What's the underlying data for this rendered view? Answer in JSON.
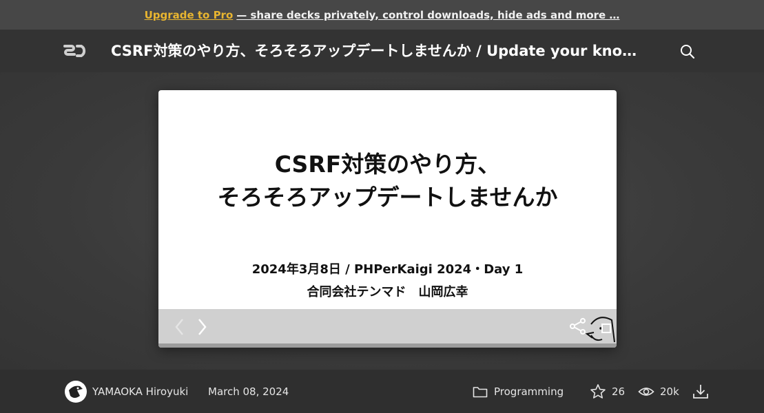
{
  "promo": {
    "link_label": "Upgrade to Pro",
    "rest_label": "— share decks privately, control downloads, hide ads and more …",
    "accent_color": "#e8b530"
  },
  "header": {
    "logo_icon": "speakerdeck-logo-icon",
    "title": "CSRF対策のやり方、そろそろアップデートしませんか / Update your knowledge of CSRF protection",
    "search_icon": "search-icon"
  },
  "slide": {
    "title_line1": "CSRF対策のやり方、",
    "title_line2": "そろそろアップデートしませんか",
    "subtitle_line1": "2024年3月8日 / PHPerKaigi 2024・Day 1",
    "subtitle_line2": "合同会社テンマド　山岡広幸",
    "controls": [
      "prev-icon",
      "next-icon",
      "share-icon",
      "fullscreen-icon"
    ]
  },
  "footer": {
    "author": "YAMAOKA Hiroyuki",
    "date": "March 08, 2024",
    "category": "Programming",
    "stars": "26",
    "views": "20k",
    "icons": [
      "avatar",
      "folder-icon",
      "star-icon",
      "eye-icon",
      "download-icon"
    ]
  }
}
